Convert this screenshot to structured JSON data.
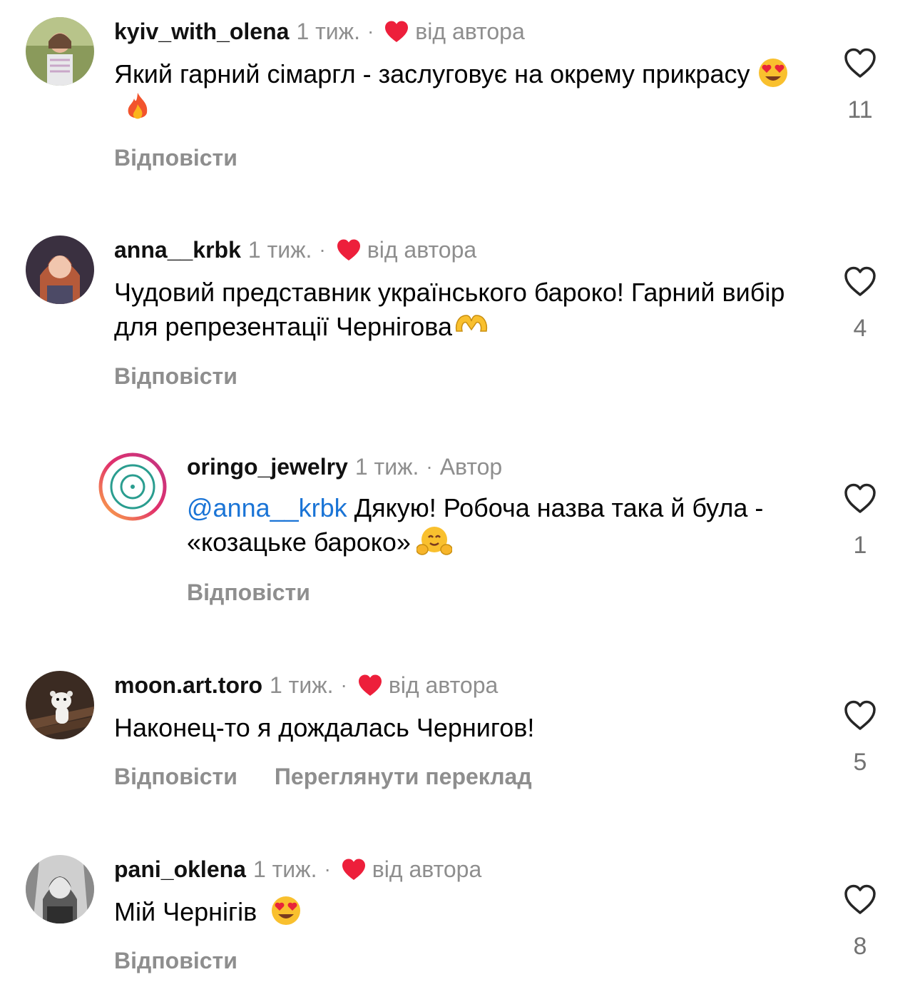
{
  "comments": [
    {
      "username": "kyiv_with_olena",
      "time": "1 тиж.",
      "dot": "·",
      "by_author": "від автора",
      "text": "Який гарний сімаргл - заслуговує на окрему прикрасу",
      "emojis": [
        "heart-eyes-emoji",
        "fire-emoji"
      ],
      "reply_label": "Відповісти",
      "likes": "11"
    },
    {
      "username": "anna__krbk",
      "time": "1 тиж.",
      "dot": "·",
      "by_author": "від автора",
      "text": "Чудовий представник українського бароко! Гарний вибір для репрезентації Чернігова",
      "emojis": [
        "heart-hands-emoji"
      ],
      "reply_label": "Відповісти",
      "likes": "4"
    },
    {
      "username": "oringo_jewelry",
      "time": "1 тиж.",
      "dot": "·",
      "author_badge": "Автор",
      "mention": "@anna__krbk",
      "text": " Дякую! Робоча назва така й була - «козацьке бароко»",
      "emojis": [
        "hugging-face-emoji"
      ],
      "reply_label": "Відповісти",
      "likes": "1"
    },
    {
      "username": "moon.art.toro",
      "time": "1 тиж.",
      "dot": "·",
      "by_author": "від автора",
      "text": "Наконец-то я дождалась Чернигов!",
      "emojis": [],
      "reply_label": "Відповісти",
      "translate_label": "Переглянути переклад",
      "likes": "5"
    },
    {
      "username": "pani_oklena",
      "time": "1 тиж.",
      "dot": "·",
      "by_author": "від автора",
      "text": "Мій Чернігів",
      "emojis": [
        "heart-eyes-emoji"
      ],
      "reply_label": "Відповісти",
      "likes": "8"
    }
  ],
  "colors": {
    "secondary_text": "#8e8e8e",
    "mention": "#1a74d6",
    "liked_by_author_heart": "#ed1f3b"
  }
}
